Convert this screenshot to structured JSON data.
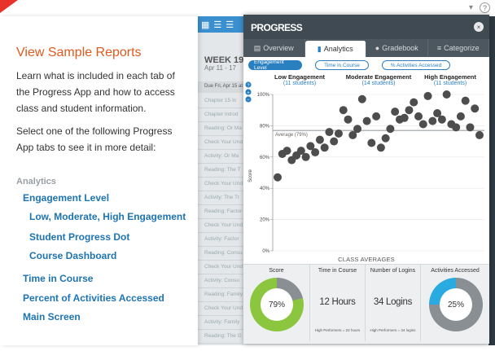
{
  "top_icons": {
    "dropdown": "▾",
    "help": "?"
  },
  "guide": {
    "title": "View Sample Reports",
    "p1": "Learn what is included in each tab of the Progress App and how to access class and student information.",
    "p2": "Select one of the following Progress App tabs to see it in more detail:",
    "section": "Analytics",
    "links": {
      "engagement": "Engagement Level",
      "lmh": "Low, Moderate, High Engagement",
      "dot": "Student Progress Dot",
      "dashboard": "Course Dashboard",
      "time": "Time in Course",
      "percent": "Percent of Activities Accessed",
      "main": "Main Screen"
    }
  },
  "background_app": {
    "week": "WEEK 19",
    "range": "Apr 11 - 17",
    "due": "Due Fri, Apr 15 at",
    "rows": [
      "Chapter 15 In",
      "Chapter Introd",
      "Reading: Or Ma",
      "Check Your Und",
      "Activity: Or Ma",
      "Reading: The T",
      "Check Your Und",
      "Activity: The Tr",
      "Reading: Factor",
      "Check Your Und",
      "Activity: Factor",
      "Reading: Consu",
      "Check Your Und",
      "Activity: Consu",
      "Reading: Family",
      "Check Your Und",
      "Activity: Family",
      "Reading: The G"
    ]
  },
  "modal": {
    "title": "PROGRESS",
    "close": "×",
    "tabs": [
      {
        "label": "Overview",
        "icon": "▤"
      },
      {
        "label": "Analytics",
        "icon": "▮"
      },
      {
        "label": "Gradebook",
        "icon": "●"
      },
      {
        "label": "Categorize",
        "icon": "≡"
      }
    ],
    "subtabs": [
      "Engagement Level",
      "Time in Course",
      "% Activities Accessed"
    ],
    "side_buttons": [
      "?",
      "+",
      "−"
    ],
    "groups": [
      {
        "label": "Low Engagement",
        "count": "(11 students)"
      },
      {
        "label": "Moderate Engagement",
        "count": "(14 students)"
      },
      {
        "label": "High Engagement",
        "count": "(11 students)"
      }
    ],
    "class_averages": {
      "heading": "CLASS AVERAGES",
      "score_label": "Score",
      "score_value": "79%",
      "time_label": "Time in Course",
      "time_value": "12 Hours",
      "time_note": "High Performers = 22 hours",
      "logins_label": "Number of Logins",
      "logins_value": "34 Logins",
      "logins_note": "High Performers = 34 logins",
      "accessed_label": "Activities Accessed",
      "accessed_value": "25%"
    }
  },
  "colors": {
    "accent_blue": "#2a7fc1",
    "title_orange": "#e05a1e",
    "donut_green": "#8cc63f",
    "donut_blue": "#29abe2",
    "dot_gray": "#4d4d4d"
  },
  "chart_data": {
    "type": "scatter",
    "ylabel": "Score",
    "ylim": [
      0,
      100
    ],
    "yticks": [
      "0%",
      "20%",
      "40%",
      "60%",
      "80%",
      "100%"
    ],
    "average": {
      "label": "Average (79%)",
      "value": 77
    },
    "series": [
      {
        "x": [
          1,
          2,
          3,
          4,
          5,
          6,
          7,
          8,
          9,
          10,
          11,
          12,
          13,
          14,
          15,
          16,
          17,
          18,
          19,
          20,
          21,
          22,
          23,
          24,
          25,
          26,
          27,
          28,
          29,
          30,
          31,
          32,
          33,
          34,
          35,
          36,
          37,
          38,
          39,
          40,
          41,
          42,
          43,
          44
        ],
        "y": [
          47,
          62,
          64,
          58,
          61,
          64,
          60,
          67,
          63,
          71,
          66,
          76,
          70,
          75,
          90,
          84,
          74,
          78,
          97,
          83,
          69,
          86,
          66,
          72,
          78,
          89,
          84,
          85,
          90,
          95,
          86,
          81,
          99,
          83,
          88,
          84,
          100,
          81,
          79,
          86,
          96,
          79,
          91,
          74
        ]
      }
    ]
  }
}
